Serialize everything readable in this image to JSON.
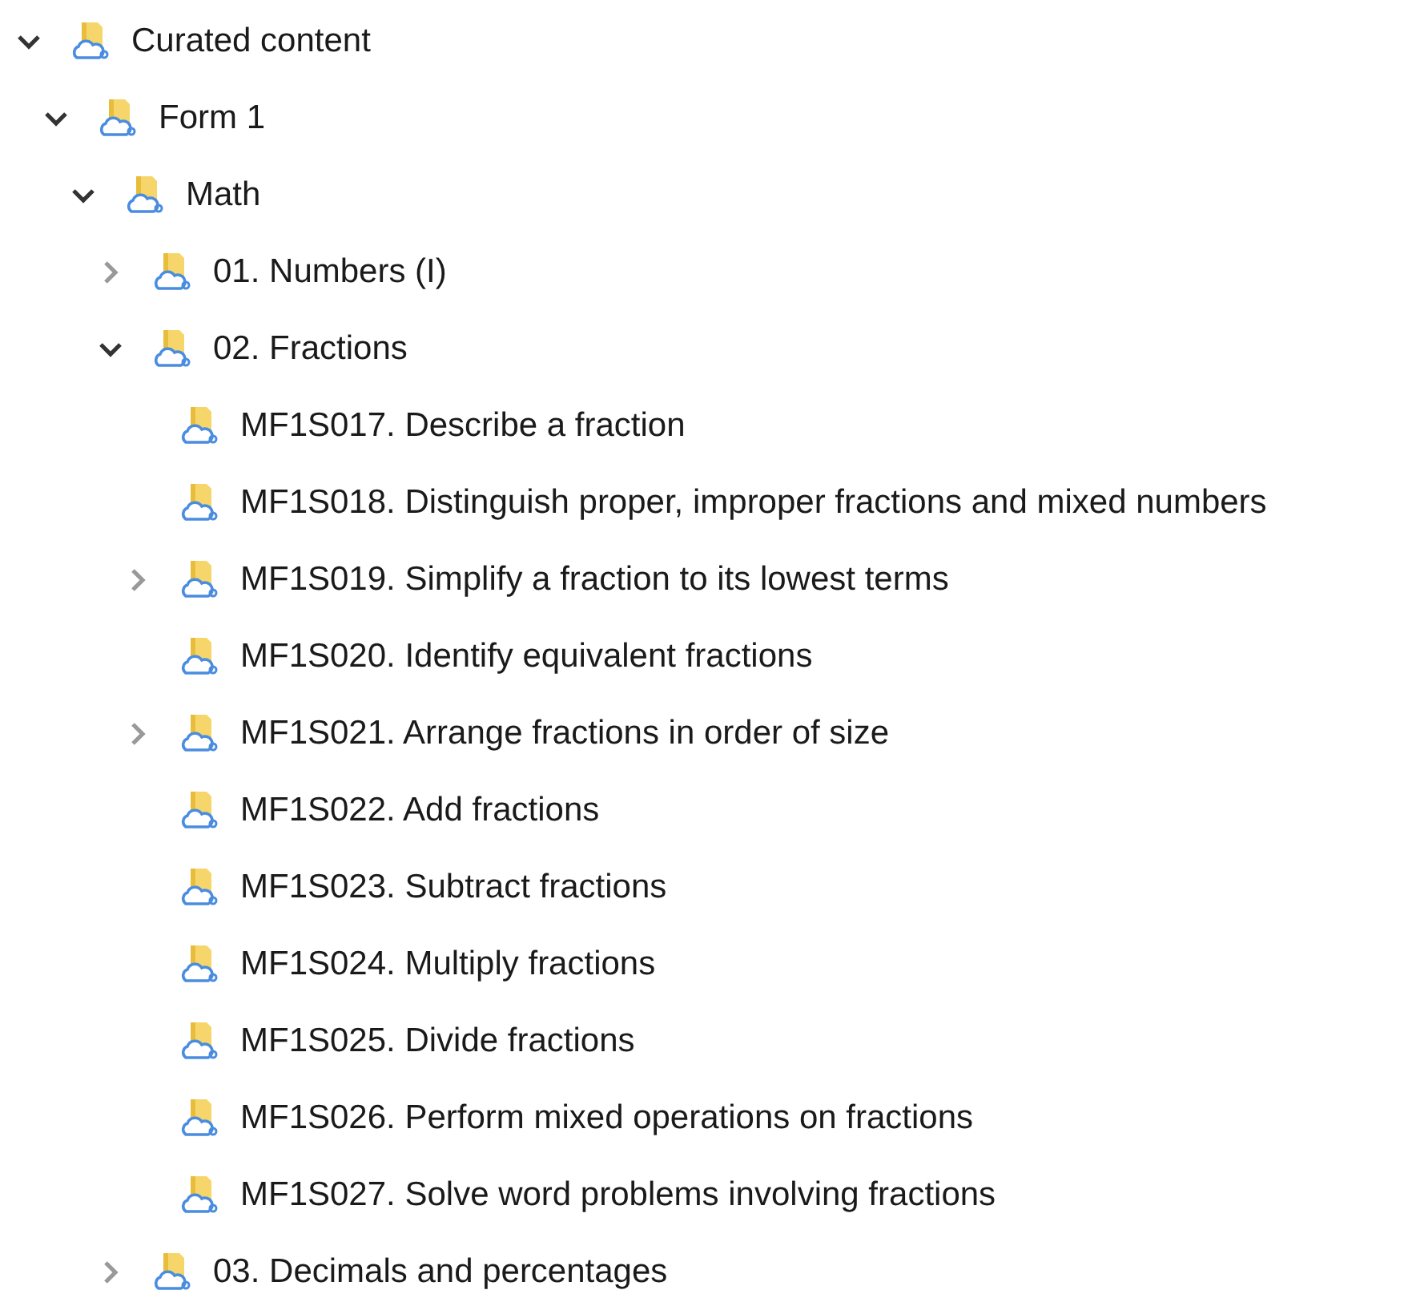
{
  "tree": [
    {
      "label": "Curated content",
      "expanded": true,
      "children": [
        {
          "label": "Form 1",
          "expanded": true,
          "children": [
            {
              "label": "Math",
              "expanded": true,
              "children": [
                {
                  "label": "01. Numbers (I)",
                  "expanded": false
                },
                {
                  "label": "02. Fractions",
                  "expanded": true,
                  "children": [
                    {
                      "label": "MF1S017. Describe a fraction"
                    },
                    {
                      "label": "MF1S018. Distinguish proper, improper fractions and mixed numbers"
                    },
                    {
                      "label": "MF1S019. Simplify a fraction to its lowest terms",
                      "expanded": false
                    },
                    {
                      "label": "MF1S020. Identify equivalent fractions"
                    },
                    {
                      "label": "MF1S021. Arrange fractions in order of size",
                      "expanded": false
                    },
                    {
                      "label": "MF1S022. Add fractions"
                    },
                    {
                      "label": "MF1S023. Subtract fractions"
                    },
                    {
                      "label": "MF1S024. Multiply fractions"
                    },
                    {
                      "label": "MF1S025. Divide fractions"
                    },
                    {
                      "label": "MF1S026. Perform mixed operations on fractions"
                    },
                    {
                      "label": "MF1S027. Solve word problems involving fractions"
                    }
                  ]
                },
                {
                  "label": "03. Decimals and percentages",
                  "expanded": false
                }
              ]
            }
          ]
        }
      ]
    }
  ]
}
